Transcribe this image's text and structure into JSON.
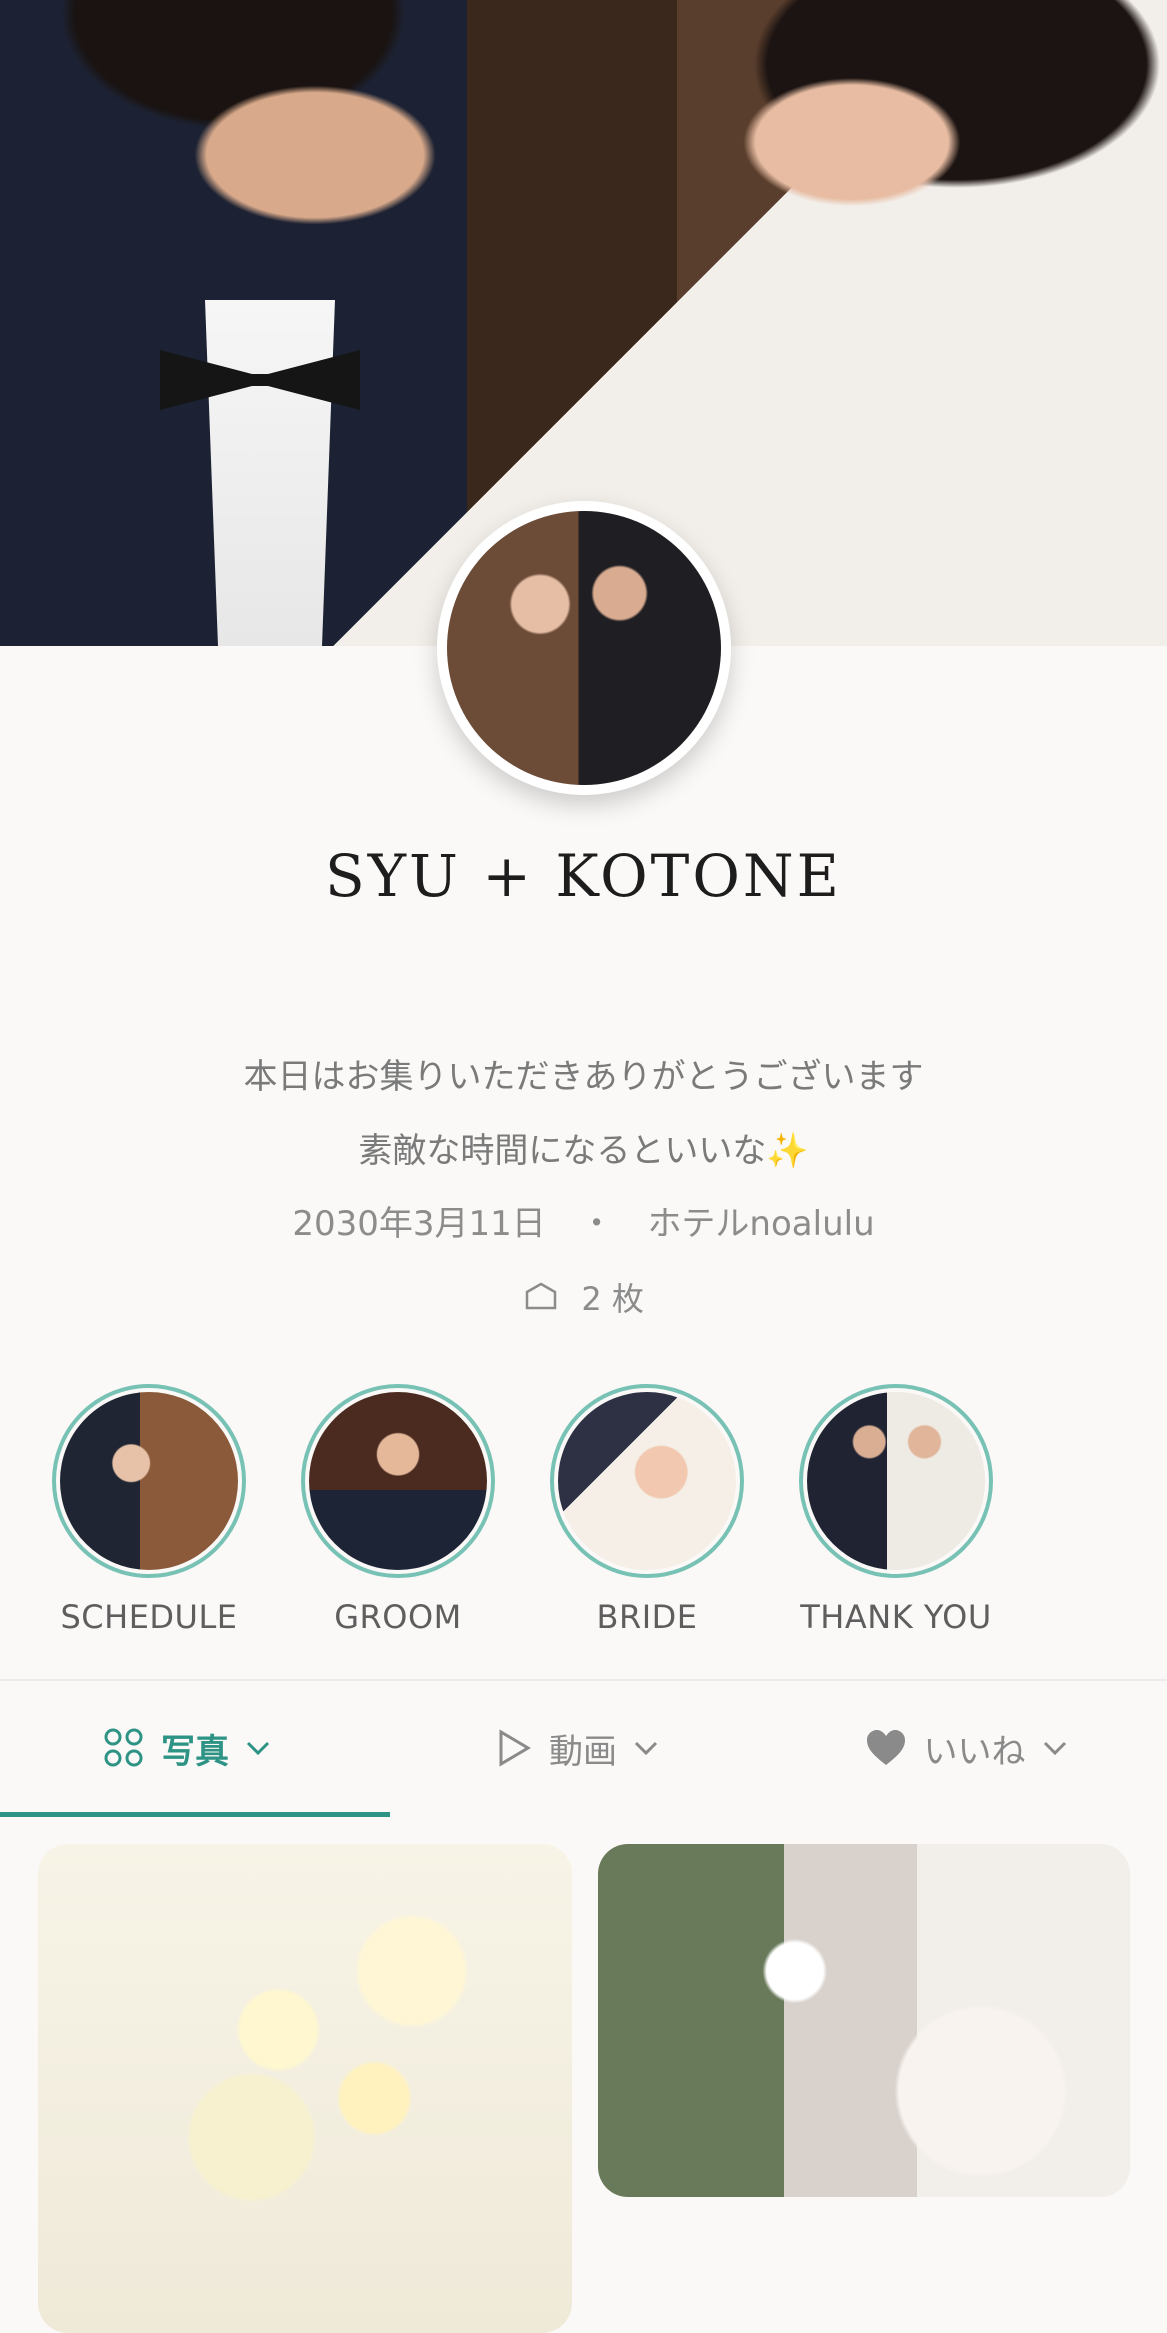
{
  "profile": {
    "title": "SYU + KOTONE",
    "message_line1": "本日はお集りいただきありがとうございます",
    "message_line2": "素敵な時間になるといいな✨",
    "date": "2030年3月11日",
    "separator": "・",
    "venue": "ホテルnoalulu",
    "count": "2 枚"
  },
  "highlights": [
    {
      "label": "SCHEDULE"
    },
    {
      "label": "GROOM"
    },
    {
      "label": "BRIDE"
    },
    {
      "label": "THANK YOU"
    }
  ],
  "tabs": [
    {
      "label": "写真",
      "icon": "grid-icon"
    },
    {
      "label": "動画",
      "icon": "play-icon"
    },
    {
      "label": "いいね",
      "icon": "heart-icon"
    }
  ],
  "colors": {
    "accent": "#2d9384",
    "ring": "#77c2b4",
    "background": "#fbf9f7"
  }
}
